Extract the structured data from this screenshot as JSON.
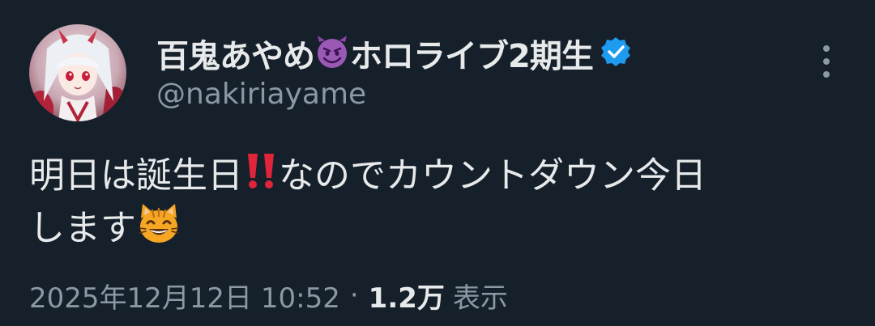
{
  "author": {
    "display_name_part1": "百鬼あやめ",
    "display_name_part2": "ホロライブ2期生",
    "handle": "@nakiriayame",
    "emoji_devil": "smiling-devil-emoji",
    "verified_icon": "verified-badge-icon",
    "avatar": "avatar-image"
  },
  "tweet": {
    "line1_part1": "明日は誕生日",
    "line1_part2": "なのでカウントダウン今日",
    "line2": "します",
    "emoji_exclamation": "double-exclamation-emoji",
    "emoji_cat": "grinning-cat-emoji"
  },
  "meta": {
    "datetime": "2025年12月12日 10:52",
    "separator": "·",
    "views_count": "1.2万",
    "views_label": "表示"
  },
  "icons": {
    "more": "more-options-icon"
  },
  "colors": {
    "background": "#15202b",
    "text": "#e7e9ea",
    "secondary": "#8b98a5",
    "verified": "#1d9bf0"
  }
}
